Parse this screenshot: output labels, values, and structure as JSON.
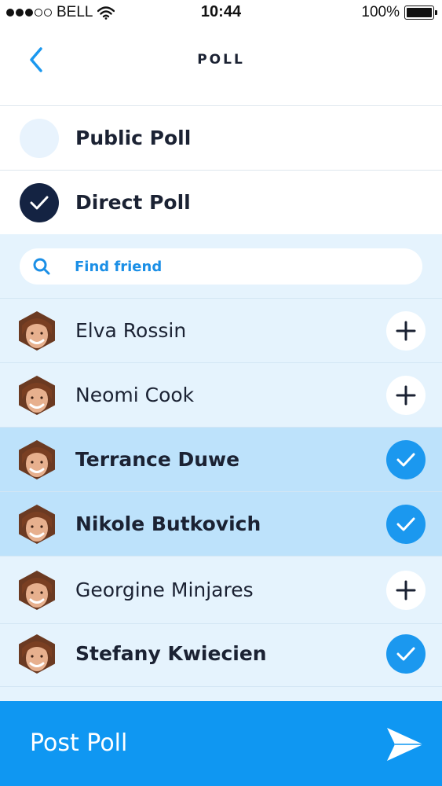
{
  "status_bar": {
    "carrier": "BELL",
    "time": "10:44",
    "battery": "100%",
    "signal_icon": "signal-icon",
    "wifi_icon": "wifi-icon",
    "battery_icon": "battery-icon"
  },
  "header": {
    "title": "POLL",
    "back_icon": "chevron-left-icon"
  },
  "poll_types": [
    {
      "label": "Public Poll",
      "selected": false
    },
    {
      "label": "Direct Poll",
      "selected": true
    }
  ],
  "search": {
    "placeholder": "Find friend",
    "icon": "search-icon"
  },
  "friends": [
    {
      "name": "Elva Rossin",
      "selected": false
    },
    {
      "name": "Neomi Cook",
      "selected": false
    },
    {
      "name": "Terrance Duwe",
      "selected": true
    },
    {
      "name": "Nikole Butkovich",
      "selected": true
    },
    {
      "name": "Georgine Minjares",
      "selected": false
    },
    {
      "name": "Stefany Kwiecien",
      "selected": true
    }
  ],
  "footer": {
    "post_label": "Post Poll",
    "send_icon": "send-icon"
  },
  "colors": {
    "accent": "#0f97f2",
    "dark": "#142342",
    "list_bg": "#e5f3fd",
    "selected_bg": "#bde2fb"
  }
}
